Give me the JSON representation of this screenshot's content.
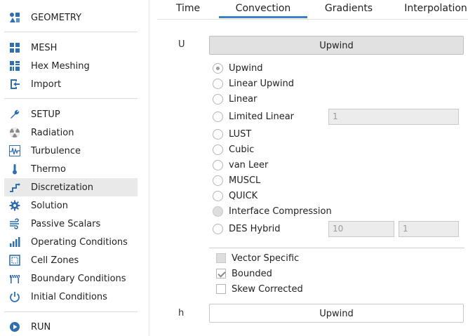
{
  "sidebar": {
    "items": [
      {
        "label": "GEOMETRY",
        "icon": "geometry-icon"
      },
      {
        "label": "MESH",
        "icon": "mesh-icon"
      },
      {
        "label": "Hex Meshing",
        "icon": "hex-meshing-icon"
      },
      {
        "label": "Import",
        "icon": "import-icon"
      },
      {
        "label": "SETUP",
        "icon": "wrench-icon"
      },
      {
        "label": "Radiation",
        "icon": "radiation-icon"
      },
      {
        "label": "Turbulence",
        "icon": "turbulence-icon"
      },
      {
        "label": "Thermo",
        "icon": "thermometer-icon"
      },
      {
        "label": "Discretization",
        "icon": "discretization-icon"
      },
      {
        "label": "Solution",
        "icon": "gear-icon"
      },
      {
        "label": "Passive Scalars",
        "icon": "wind-icon"
      },
      {
        "label": "Operating Conditions",
        "icon": "bar-chart-icon"
      },
      {
        "label": "Cell Zones",
        "icon": "cell-zones-icon"
      },
      {
        "label": "Boundary Conditions",
        "icon": "boundary-icon"
      },
      {
        "label": "Initial Conditions",
        "icon": "power-icon"
      },
      {
        "label": "RUN",
        "icon": "play-icon"
      }
    ],
    "active": "Discretization"
  },
  "tabs": [
    {
      "label": "Time",
      "active": false
    },
    {
      "label": "Convection",
      "active": true
    },
    {
      "label": "Gradients",
      "active": false
    },
    {
      "label": "Interpolation",
      "active": false
    }
  ],
  "convection": {
    "u_label": "U",
    "u_scheme": "Upwind",
    "options": [
      {
        "label": "Upwind",
        "selected": true
      },
      {
        "label": "Linear Upwind"
      },
      {
        "label": "Linear"
      },
      {
        "label": "Limited Linear",
        "value": "1"
      },
      {
        "label": "LUST"
      },
      {
        "label": "Cubic"
      },
      {
        "label": "van Leer"
      },
      {
        "label": "MUSCL"
      },
      {
        "label": "QUICK"
      },
      {
        "label": "Interface Compression",
        "disabled": true
      },
      {
        "label": "DES Hybrid",
        "value1": "10",
        "value2": "1"
      }
    ],
    "checks": [
      {
        "label": "Vector Specific",
        "disabled": true,
        "checked": false
      },
      {
        "label": "Bounded",
        "checked": true
      },
      {
        "label": "Skew Corrected",
        "checked": false
      }
    ],
    "h_label": "h",
    "h_scheme": "Upwind"
  },
  "colors": {
    "accent": "#3a82c4",
    "icon": "#2f6fb0",
    "active_bg": "#e9e9e9"
  }
}
